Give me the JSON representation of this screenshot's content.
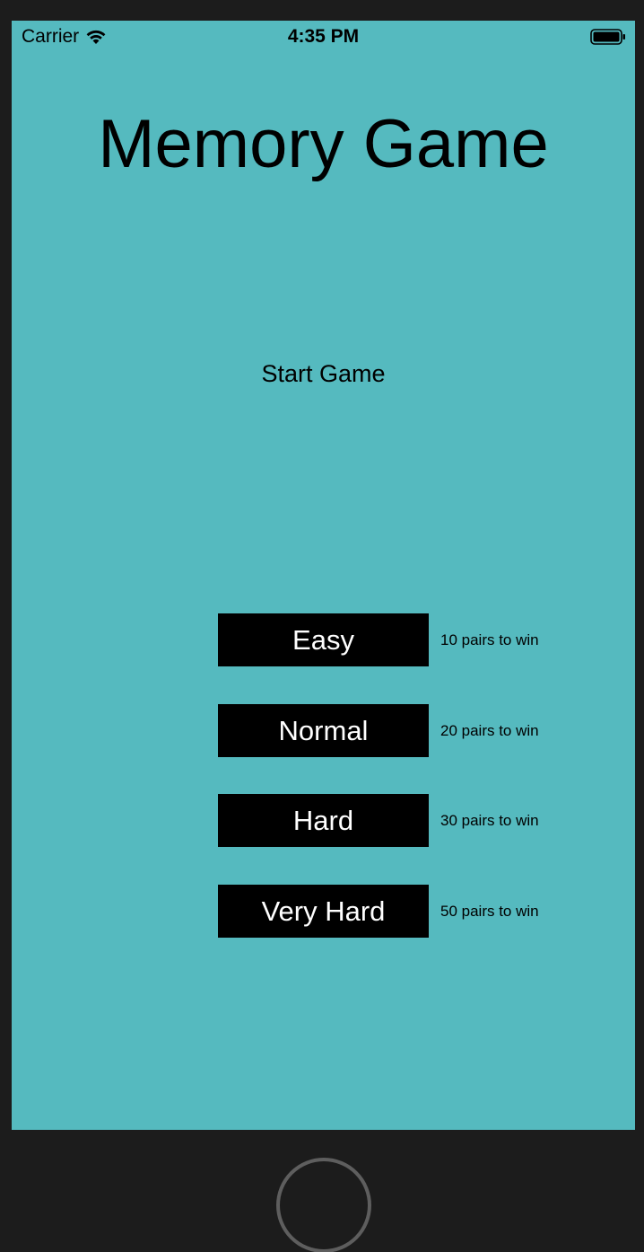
{
  "status_bar": {
    "carrier": "Carrier",
    "time": "4:35 PM"
  },
  "title": "Memory Game",
  "start_label": "Start Game",
  "levels": [
    {
      "label": "Easy",
      "note": "10 pairs to win"
    },
    {
      "label": "Normal",
      "note": "20 pairs to win"
    },
    {
      "label": "Hard",
      "note": "30 pairs to win"
    },
    {
      "label": "Very Hard",
      "note": "50 pairs to win"
    }
  ],
  "colors": {
    "background": "#55babf",
    "button": "#000000",
    "button_text": "#ffffff",
    "device_frame": "#1c1c1c"
  },
  "icons": [
    "wifi-icon",
    "battery-icon",
    "home-button"
  ]
}
